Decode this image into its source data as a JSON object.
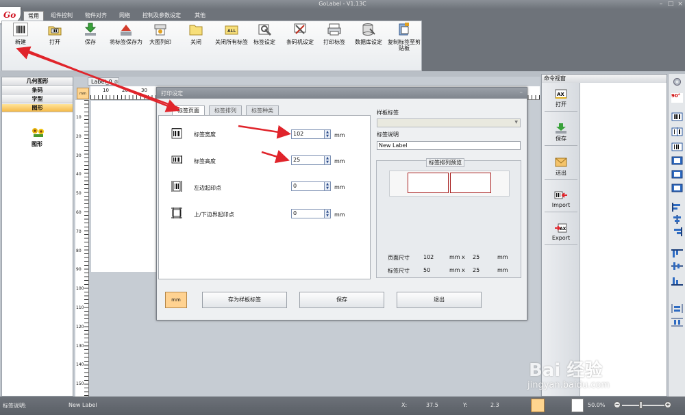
{
  "app": {
    "title": "GoLabel - V1.13C",
    "logo_text": "Go"
  },
  "menu": {
    "tabs": [
      "常用",
      "组件控制",
      "物件对齐",
      "网络",
      "控制及参数设定",
      "其他"
    ]
  },
  "ribbon": {
    "buttons": [
      {
        "label": "新建",
        "icon": "new-barcode-icon"
      },
      {
        "label": "打开",
        "icon": "open-icon"
      },
      {
        "label": "保存",
        "icon": "save-icon"
      },
      {
        "label": "将标签保存为",
        "icon": "save-as-icon"
      },
      {
        "label": "大图列印",
        "icon": "big-print-icon"
      },
      {
        "label": "关闭",
        "icon": "folder-close-icon"
      },
      {
        "label": "关闭所有标签",
        "icon": "close-all-icon"
      },
      {
        "label": "标签设定",
        "icon": "label-settings-icon"
      },
      {
        "label": "条码机设定",
        "icon": "printer-settings-icon"
      },
      {
        "label": "打印标签",
        "icon": "print-icon"
      },
      {
        "label": "数据库设定",
        "icon": "database-icon"
      },
      {
        "label": "复制标签至剪贴板",
        "icon": "copy-clipboard-icon"
      }
    ]
  },
  "left_panel": {
    "items": [
      "几何图形",
      "条码",
      "字型",
      "图形"
    ],
    "active": "图形",
    "graphic_label": "图形"
  },
  "document": {
    "tab": "Label_0",
    "ruler_h": [
      "10",
      "20",
      "30"
    ],
    "ruler_v": [
      "10",
      "20",
      "30",
      "40",
      "50",
      "60",
      "70",
      "80",
      "90",
      "100",
      "110",
      "120",
      "130",
      "140",
      "150"
    ]
  },
  "dialog": {
    "title": "打印设定",
    "tabs": [
      "标签页面",
      "标签排列",
      "标签种类"
    ],
    "rows": [
      {
        "label": "标签宽度",
        "value": "102",
        "unit": "mm"
      },
      {
        "label": "标签高度",
        "value": "25",
        "unit": "mm"
      },
      {
        "label": "左边起印点",
        "value": "0",
        "unit": "mm"
      },
      {
        "label": "上/下边界起印点",
        "value": "0",
        "unit": "mm"
      }
    ],
    "template_label": "样板标签",
    "template_value": "",
    "desc_label": "标签说明",
    "desc_value": "New Label",
    "preview_title": "标签排列预览",
    "page_size_label": "页面尺寸",
    "page_w": "102",
    "page_h": "25",
    "label_size_label": "标签尺寸",
    "label_w": "50",
    "label_h": "25",
    "unit_mm": "mm",
    "times": "x",
    "buttons": {
      "unit": "mm",
      "save_template": "存为样板标签",
      "save": "保存",
      "exit": "退出"
    }
  },
  "command_panel": {
    "title": "命令视窗",
    "commands": [
      {
        "label": "打开",
        "icon": "ax-open-icon"
      },
      {
        "label": "保存",
        "icon": "save-icon"
      },
      {
        "label": "送出",
        "icon": "send-icon"
      },
      {
        "label": "Import",
        "icon": "import-icon"
      },
      {
        "label": "Export",
        "icon": "export-icon"
      }
    ]
  },
  "toolstrip": {
    "rotate_label": "90°"
  },
  "status": {
    "desc_label": "标签说明:",
    "desc_value": "New Label",
    "x_label": "X:",
    "x_value": "37.5",
    "y_label": "Y:",
    "y_value": "2.3",
    "zoom": "50.0%"
  },
  "watermark": {
    "main": "Bai 经验",
    "sub": "jingyan.baidu.com"
  },
  "colors": {
    "accent_red": "#e0242b",
    "active_tab": "#f5b948",
    "title_gray": "#6e737a"
  }
}
